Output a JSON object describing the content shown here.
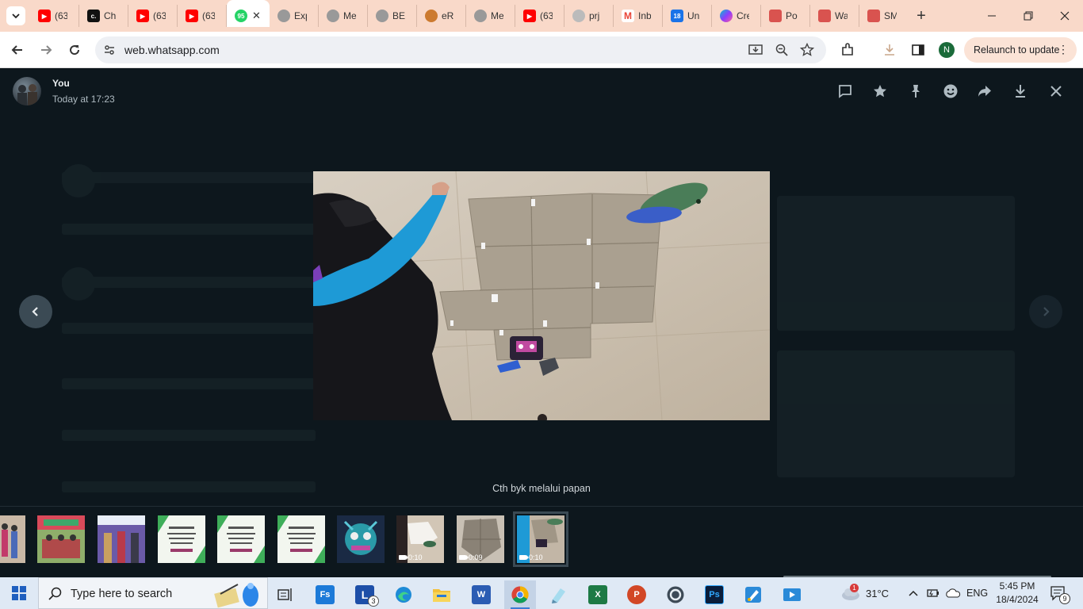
{
  "browser": {
    "tabs": [
      {
        "label": "(63",
        "favicon": "youtube-icon",
        "color": "#ff0000"
      },
      {
        "label": "Ch",
        "favicon": "character-ai-icon",
        "color": "#111111"
      },
      {
        "label": "(63",
        "favicon": "youtube-icon",
        "color": "#ff0000"
      },
      {
        "label": "(63",
        "favicon": "youtube-icon",
        "color": "#ff0000"
      },
      {
        "label": "95",
        "favicon": "whatsapp-icon",
        "color": "#25d366",
        "active": true
      },
      {
        "label": "Exp",
        "favicon": "globe-icon",
        "color": "#888888"
      },
      {
        "label": "Me",
        "favicon": "globe-icon",
        "color": "#888888"
      },
      {
        "label": "BEI",
        "favicon": "globe-icon",
        "color": "#888888"
      },
      {
        "label": "eRi",
        "favicon": "erph-icon",
        "color": "#cc7a2f"
      },
      {
        "label": "Me",
        "favicon": "globe-icon",
        "color": "#888888"
      },
      {
        "label": "(63",
        "favicon": "youtube-icon",
        "color": "#ff0000"
      },
      {
        "label": "prj",
        "favicon": "globe-icon",
        "color": "#aaaaaa"
      },
      {
        "label": "Inb",
        "favicon": "gmail-icon",
        "color": "#ea4335"
      },
      {
        "label": "Un",
        "favicon": "calendar-icon",
        "color": "#1a73e8"
      },
      {
        "label": "Cre",
        "favicon": "canva-icon",
        "color": "#8b3dff"
      },
      {
        "label": "Po",
        "favicon": "pdf-icon",
        "color": "#d9534f"
      },
      {
        "label": "Wa",
        "favicon": "pdf-icon",
        "color": "#d9534f"
      },
      {
        "label": "SM",
        "favicon": "pdf-icon",
        "color": "#d9534f"
      }
    ],
    "url": "web.whatsapp.com",
    "relaunch_label": "Relaunch to update",
    "profile_initial": "N"
  },
  "viewer": {
    "sender": "You",
    "timestamp": "Today at 17:23",
    "caption": "Cth byk melalui papan",
    "header_actions": [
      "reply-icon",
      "star-icon",
      "pin-icon",
      "emoji-icon",
      "forward-icon",
      "download-icon",
      "close-icon"
    ],
    "thumbnails": [
      {
        "kind": "image",
        "name": "people-photo"
      },
      {
        "kind": "image",
        "name": "group-photo"
      },
      {
        "kind": "image",
        "name": "stage-photo"
      },
      {
        "kind": "image",
        "name": "invitation-card"
      },
      {
        "kind": "image",
        "name": "invitation-card"
      },
      {
        "kind": "image",
        "name": "invitation-card"
      },
      {
        "kind": "image",
        "name": "robot-photo"
      },
      {
        "kind": "video",
        "duration": "0:10"
      },
      {
        "kind": "video",
        "duration": "0:09"
      },
      {
        "kind": "video",
        "duration": "0:10",
        "selected": true
      }
    ]
  },
  "taskbar": {
    "search_placeholder": "Type here to search",
    "weather_temp": "31°C",
    "weather_alert": "1",
    "language": "ENG",
    "time": "5:45 PM",
    "date": "18/4/2024",
    "notification_count": "9",
    "lync_badge": "3",
    "apps": [
      "search-widget-icon",
      "task-view-icon",
      "fs-app-icon",
      "lync-icon",
      "edge-icon",
      "file-explorer-icon",
      "word-icon",
      "chrome-icon",
      "notes-icon",
      "excel-icon",
      "powerpoint-icon",
      "obs-icon",
      "photoshop-icon",
      "paint-icon",
      "video-editor-icon"
    ]
  }
}
